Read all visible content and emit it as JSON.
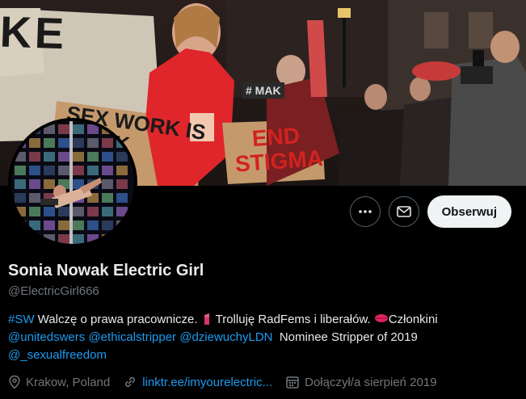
{
  "profile": {
    "display_name": "Sonia Nowak Electric Girl",
    "handle": "@ElectricGirl666",
    "follow_label": "Obserwuj"
  },
  "banner": {
    "sign_left": "SEX WORK IS WORK",
    "sign_right": "END STIGMA",
    "sign_top": "KE",
    "sign_small": "# MAK"
  },
  "bio": {
    "hashtag": "#SW",
    "text1": " Walczę o prawa pracownicze.",
    "text2": " Trolluję RadFems i liberałów.",
    "text3": "Członkini ",
    "mention1": "@unitedswers",
    "mention2": "@ethicalstripper",
    "mention3": "@dziewuchyLDN",
    "text4": "  Nominee Stripper of 2019 ",
    "mention4": "@_sexualfreedom"
  },
  "meta": {
    "location": "Krakow, Poland",
    "website": "linktr.ee/imyourelectric...",
    "joined": "Dołączył/a sierpień 2019"
  },
  "icons": {
    "more": "more-icon",
    "message": "envelope-icon",
    "location": "location-pin-icon",
    "link": "link-icon",
    "calendar": "calendar-icon"
  },
  "colors": {
    "link": "#1d9bf0",
    "muted": "#71767b",
    "follow_bg": "#eff3f4"
  }
}
